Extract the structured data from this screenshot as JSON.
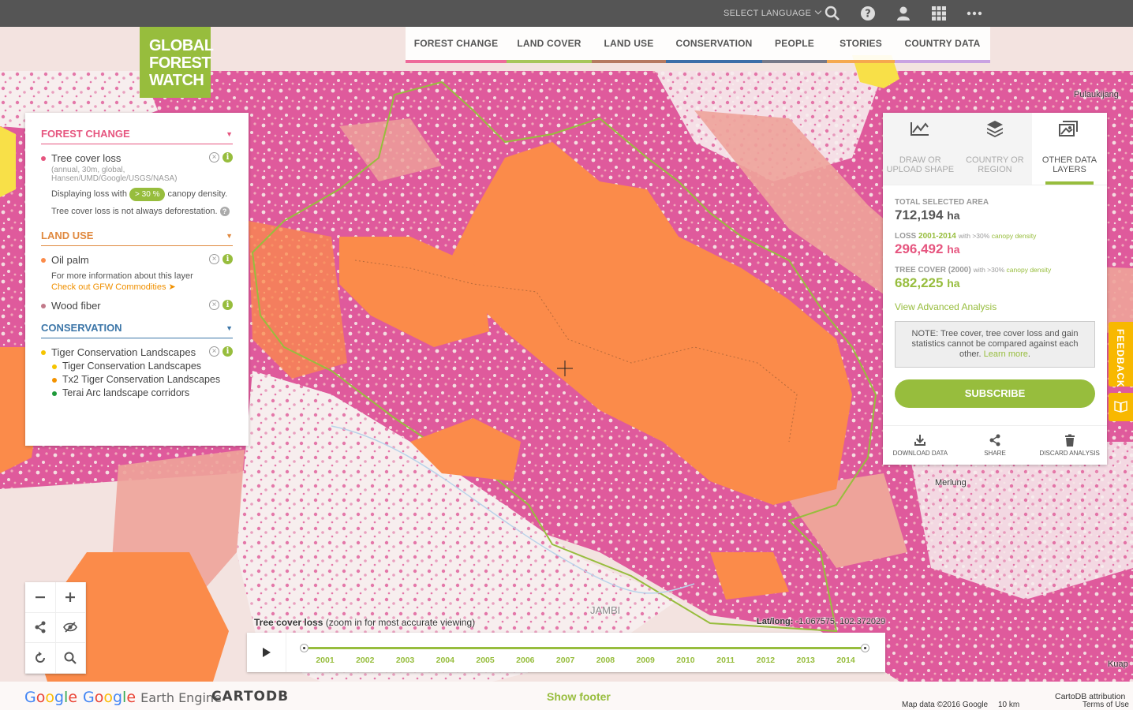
{
  "topbar": {
    "language_label": "SELECT LANGUAGE",
    "icons": [
      "search-icon",
      "help-icon",
      "user-icon",
      "apps-grid-icon",
      "more-icon"
    ]
  },
  "logo": {
    "line1": "GLOBAL",
    "line2": "FOREST",
    "line3": "WATCH",
    "color": "#97bd3d"
  },
  "nav": [
    {
      "label": "FOREST CHANGE",
      "color": "#ee6a9a"
    },
    {
      "label": "LAND COVER",
      "color": "#a7c65a"
    },
    {
      "label": "LAND USE",
      "color": "#b57a60"
    },
    {
      "label": "CONSERVATION",
      "color": "#3c6fa7"
    },
    {
      "label": "PEOPLE",
      "color": "#777a88"
    },
    {
      "label": "STORIES",
      "color": "#f5a94e"
    },
    {
      "label": "COUNTRY DATA",
      "color": "#c9a2e2"
    }
  ],
  "left_panel": {
    "forest_change": {
      "title": "FOREST CHANGE",
      "color": "#e6557f",
      "layer_name": "Tree cover loss",
      "layer_source": "(annual, 30m, global, Hansen/UMD/Google/USGS/NASA)",
      "displaying_prefix": "Displaying loss with",
      "canopy_pill": "> 30 %",
      "displaying_suffix": "canopy density.",
      "note": "Tree cover loss is not always deforestation."
    },
    "land_use": {
      "title": "LAND USE",
      "color": "#e0893f",
      "oil_palm": "Oil palm",
      "oil_palm_info": "For more information about this layer",
      "oil_palm_link": "Check out GFW Commodities ➤",
      "wood_fiber": "Wood fiber"
    },
    "conservation": {
      "title": "CONSERVATION",
      "color": "#3c76a8",
      "layer_name": "Tiger Conservation Landscapes",
      "sublayers": [
        {
          "name": "Tiger Conservation Landscapes",
          "color": "#f5c400"
        },
        {
          "name": "Tx2 Tiger Conservation Landscapes",
          "color": "#f39200"
        },
        {
          "name": "Terai Arc landscape corridors",
          "color": "#1f9a3a"
        }
      ]
    }
  },
  "right_panel": {
    "tabs": [
      {
        "label": "DRAW OR UPLOAD SHAPE",
        "icon": "chart-area-icon"
      },
      {
        "label": "COUNTRY OR REGION",
        "icon": "layers-icon"
      },
      {
        "label": "OTHER DATA LAYERS",
        "icon": "image-layers-icon"
      }
    ],
    "total_label": "TOTAL SELECTED AREA",
    "total_value": "712,194",
    "total_unit": "ha",
    "loss_label": "LOSS",
    "loss_years": "2001-2014",
    "loss_qual_prefix": "with >30%",
    "loss_qual_suffix": "canopy density",
    "loss_value": "296,492",
    "loss_unit": "ha",
    "cover_label": "TREE COVER (2000)",
    "cover_qual_prefix": "with >30%",
    "cover_qual_suffix": "canopy density",
    "cover_value": "682,225",
    "cover_unit": "ha",
    "advanced_link": "View Advanced Analysis",
    "note_text": "NOTE: Tree cover, tree cover loss and gain statistics cannot be compared against each other.",
    "note_link": "Learn more",
    "subscribe": "SUBSCRIBE",
    "actions": [
      "DOWNLOAD DATA",
      "SHARE",
      "DISCARD ANALYSIS"
    ]
  },
  "feedback_label": "FEEDBACK",
  "map_labels": {
    "top_right": "Pulaukijang",
    "merlung": "Merlung",
    "jambi": "JAMBI",
    "kuap": "Kuap"
  },
  "timeline": {
    "title": "Tree cover loss",
    "title_suffix": "(zoom in for most accurate viewing)",
    "latlong_label": "Lat/long:",
    "latlong_value": "-1.067575, 102.372029",
    "years": [
      "2001",
      "2002",
      "2003",
      "2004",
      "2005",
      "2006",
      "2007",
      "2008",
      "2009",
      "2010",
      "2011",
      "2012",
      "2013",
      "2014"
    ],
    "range_start": "2001",
    "range_end": "2014"
  },
  "footer": {
    "google": "Google",
    "earth_engine": "Earth Engine",
    "cartodb": "CARTODB",
    "show_footer": "Show footer",
    "map_data": "Map data ©2016 Google",
    "scale": "10 km",
    "carto_attrib": "CartoDB attribution",
    "terms": "Terms of Use"
  },
  "colors": {
    "loss_pink": "#df5a9c",
    "oil_palm_orange": "#fb8b4a",
    "wood_fiber_salmon": "#eea39a",
    "boundary_green": "#97bd3d",
    "accent_green": "#97bd3d",
    "loss_value_pink": "#e6557f"
  }
}
